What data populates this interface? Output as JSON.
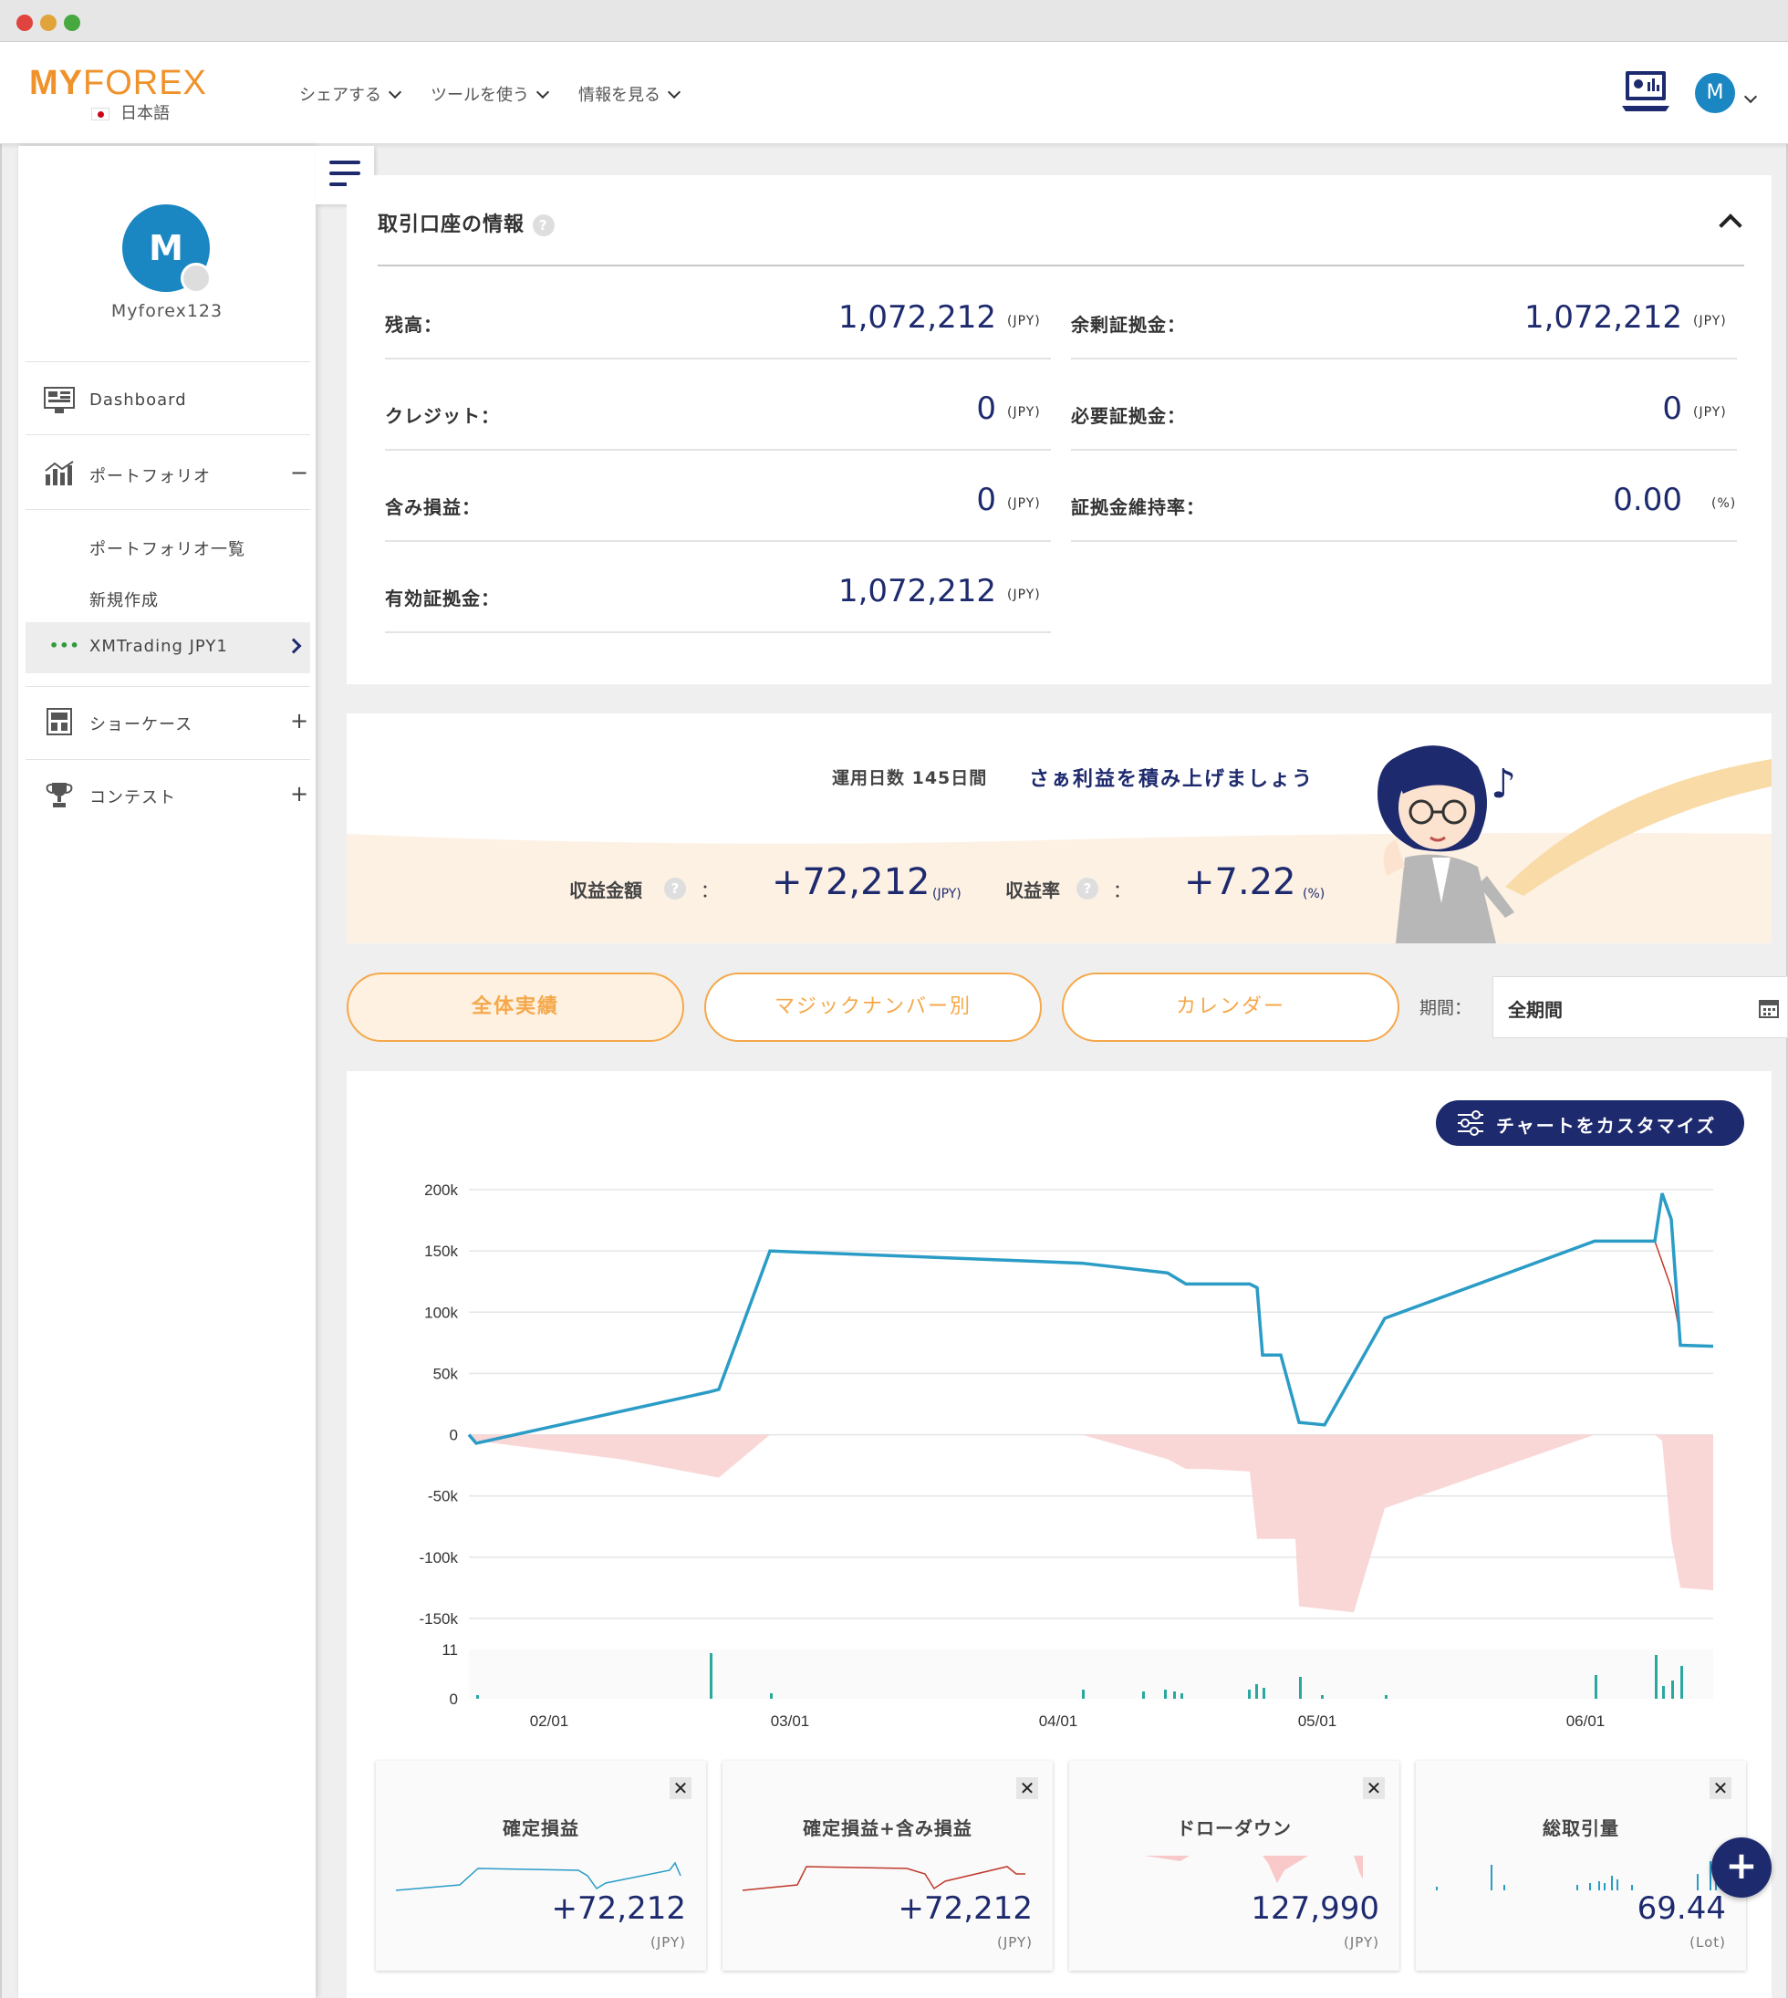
{
  "header": {
    "logo_my": "MY",
    "logo_forex": "FOREX",
    "language": "日本語",
    "nav": [
      "シェアする",
      "ツールを使う",
      "情報を見る"
    ],
    "user_initial": "M"
  },
  "sidebar": {
    "avatar_initial": "M",
    "username": "Myforex123",
    "items": [
      {
        "label": "Dashboard",
        "icon": "monitor-icon"
      },
      {
        "label": "ポートフォリオ",
        "icon": "chart-icon",
        "toggle": "−"
      },
      {
        "label": "ポートフォリオ一覧"
      },
      {
        "label": "新規作成"
      },
      {
        "label": "XMTrading JPY1",
        "prefix": "•••"
      },
      {
        "label": "ショーケース",
        "icon": "showcase-icon",
        "toggle": "+"
      },
      {
        "label": "コンテスト",
        "icon": "trophy-icon",
        "toggle": "+"
      }
    ]
  },
  "account": {
    "title": "取引口座の情報",
    "help": "?",
    "rows": [
      {
        "label": "残高：",
        "value": "1,072,212",
        "unit": "(JPY)"
      },
      {
        "label": "余剰証拠金：",
        "value": "1,072,212",
        "unit": "(JPY)"
      },
      {
        "label": "クレジット：",
        "value": "0",
        "unit": "(JPY)"
      },
      {
        "label": "必要証拠金：",
        "value": "0",
        "unit": "(JPY)"
      },
      {
        "label": "含み損益：",
        "value": "0",
        "unit": "(JPY)"
      },
      {
        "label": "証拠金維持率：",
        "value": "0.00",
        "unit": "(%)"
      },
      {
        "label": "有効証拠金：",
        "value": "1,072,212",
        "unit": "(JPY)"
      }
    ]
  },
  "banner": {
    "days_label": "運用日数 145日間",
    "message": "さぁ利益を積み上げましょう",
    "profit_label": "収益金額",
    "profit_value": "+72,212",
    "profit_unit": "(JPY)",
    "rate_label": "収益率",
    "rate_value": "+7.22",
    "rate_unit": "(%)",
    "colon": "：",
    "note": "♪"
  },
  "tabs": [
    "全体実績",
    "マジックナンバー別",
    "カレンダー"
  ],
  "period": {
    "label": "期間：",
    "value": "全期間"
  },
  "chart": {
    "customize_label": "チャートをカスタマイズ"
  },
  "chart_data": {
    "type": "line",
    "x_ticks": [
      "02/01",
      "03/01",
      "04/01",
      "05/01",
      "06/01"
    ],
    "y_ticks": [
      "200k",
      "150k",
      "100k",
      "50k",
      "0",
      "-50k",
      "-100k",
      "-150k"
    ],
    "ylim": [
      -150000,
      200000
    ],
    "volume_ticks": [
      "11",
      "0"
    ],
    "series": [
      {
        "values": [
          0,
          -7000,
          35000,
          37000,
          150000,
          140000,
          132000,
          123000,
          123000,
          123000,
          120000,
          65000,
          65000,
          10000,
          8000,
          95000,
          158000,
          158000,
          197000,
          176000,
          73000,
          72212
        ]
      },
      {
        "values": [
          0,
          -5000,
          -20000,
          -35000,
          0,
          0,
          -20000,
          -28000,
          -28000,
          -30000,
          -85000,
          -85000,
          -140000,
          -145000,
          -60000,
          0,
          0,
          -5000,
          -85000,
          -125000,
          -127000
        ]
      }
    ],
    "line_color": "#2a9cc6",
    "drawdown_color": "#f7c9c9"
  },
  "cards": [
    {
      "title": "確定損益",
      "value": "+72,212",
      "unit": "(JPY)"
    },
    {
      "title": "確定損益+含み損益",
      "value": "+72,212",
      "unit": "(JPY)"
    },
    {
      "title": "ドローダウン",
      "value": "127,990",
      "unit": "(JPY)"
    },
    {
      "title": "総取引量",
      "value": "69.44",
      "unit": "(Lot)"
    }
  ],
  "colors": {
    "accent": "#f5a84a",
    "navy": "#1e2a6e",
    "blue": "#1a86c2"
  },
  "close_symbol": "✕",
  "fab_symbol": "+"
}
